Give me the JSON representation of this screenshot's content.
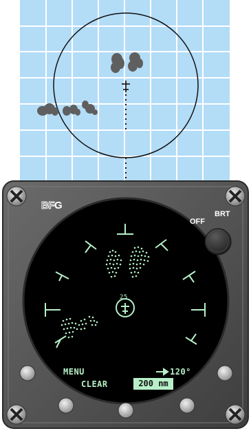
{
  "brand": {
    "logo_text_outline": "BF",
    "logo_text_solid": "G"
  },
  "knob": {
    "off_label": "OFF",
    "brt_label": "BRT"
  },
  "display": {
    "tilt_angle": "25",
    "menu_label": "MENU",
    "clear_label": "CLEAR",
    "heading_value": "120°",
    "range_value": "200 nm"
  },
  "colors": {
    "sky_grid": "#b3dcf7",
    "grid_lines": "#ffffff",
    "storm_cells": "#5f5f5f",
    "display_green": "#b7f0c8",
    "bezel": "#555555",
    "screen": "#000000"
  }
}
